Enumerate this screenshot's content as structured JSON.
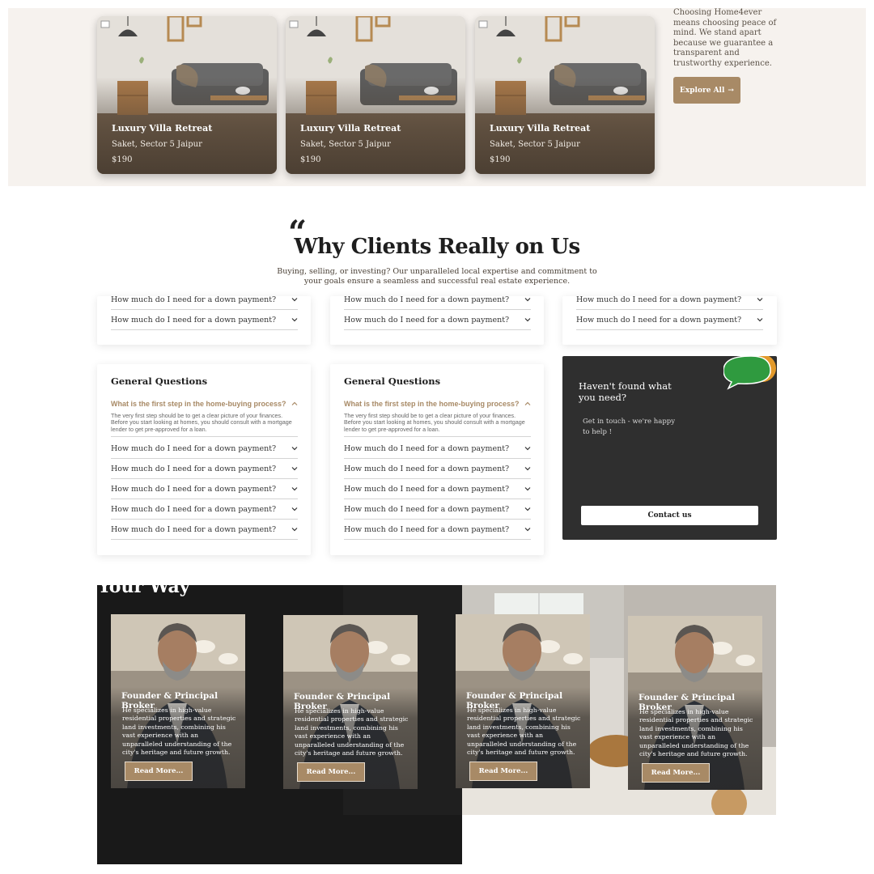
{
  "properties": {
    "cards": [
      {
        "title": "Luxury Villa Retreat",
        "location": "Saket, Sector 5 Jaipur",
        "price": "$190"
      },
      {
        "title": "Luxury Villa Retreat",
        "location": "Saket, Sector 5 Jaipur",
        "price": "$190"
      },
      {
        "title": "Luxury Villa Retreat",
        "location": "Saket, Sector 5 Jaipur",
        "price": "$190"
      }
    ],
    "aside_text": "Choosing Home4ever means choosing peace of mind. We stand apart because we guarantee a transparent and trustworthy experience.",
    "explore_label": "Explore All",
    "explore_arrow": "→"
  },
  "faq": {
    "quote_glyph": "“",
    "title": "Why Clients Really on Us",
    "subtitle": "Buying, selling, or investing? Our unparalleled local expertise and commitment to your goals ensure a seamless and successful real estate experience.",
    "top_cards": [
      {
        "rows": [
          "How much do I need for a down payment?",
          "How much do I need for a down payment?"
        ]
      },
      {
        "rows": [
          "How much do I need for a down payment?",
          "How much do I need for a down payment?"
        ]
      },
      {
        "rows": [
          "How much do I need for a down payment?",
          "How much do I need for a down payment?"
        ]
      }
    ],
    "bottom_cards": [
      {
        "heading": "General Questions",
        "open_question": "What is the first step in the home-buying process?",
        "open_answer": "The very first step should be to get a clear picture of your finances. Before you start looking at homes, you should consult with a mortgage lender to get pre-approved for a loan.",
        "rows": [
          "How much do I need for a down payment?",
          "How much do I need for a down payment?",
          "How much do I need for a down payment?",
          "How much do I need for a down payment?",
          "How much do I need for a down payment?"
        ]
      },
      {
        "heading": "General Questions",
        "open_question": "What is the first step in the home-buying process?",
        "open_answer": "The very first step should be to get a clear picture of your finances. Before you start looking at homes, you should consult with a mortgage lender to get pre-approved for a loan.",
        "rows": [
          "How much do I need for a down payment?",
          "How much do I need for a down payment?",
          "How much do I need for a down payment?",
          "How much do I need for a down payment?",
          "How much do I need for a down payment?"
        ]
      }
    ],
    "help": {
      "title": "Haven't found what you need?",
      "subtitle": "Get in touch - we're happy to help !",
      "button": "Contact us"
    }
  },
  "team": {
    "heading": "Your Way",
    "brokers": [
      {
        "title": "Founder & Principal Broker",
        "desc": "He specializes in high-value residential properties and strategic land investments, combining his vast experience with an unparalleled understanding of the city's heritage and future growth.",
        "button": "Read More..."
      },
      {
        "title": "Founder & Principal Broker",
        "desc": "He specializes in high-value residential properties and strategic land investments, combining his vast experience with an unparalleled understanding of the city's heritage and future growth.",
        "button": "Read More..."
      },
      {
        "title": "Founder & Principal Broker",
        "desc": "He specializes in high-value residential properties and strategic land investments, combining his vast experience with an unparalleled understanding of the city's heritage and future growth.",
        "button": "Read More..."
      },
      {
        "title": "Founder & Principal Broker",
        "desc": "He specializes in high-value residential properties and strategic land investments, combining his vast experience with an unparalleled understanding of the city's heritage and future growth.",
        "button": "Read More..."
      }
    ]
  },
  "colors": {
    "accent": "#a88a66",
    "band_bg": "#f6f2ee",
    "help_bg": "#2f2f2f",
    "dark_bg": "#191919"
  }
}
